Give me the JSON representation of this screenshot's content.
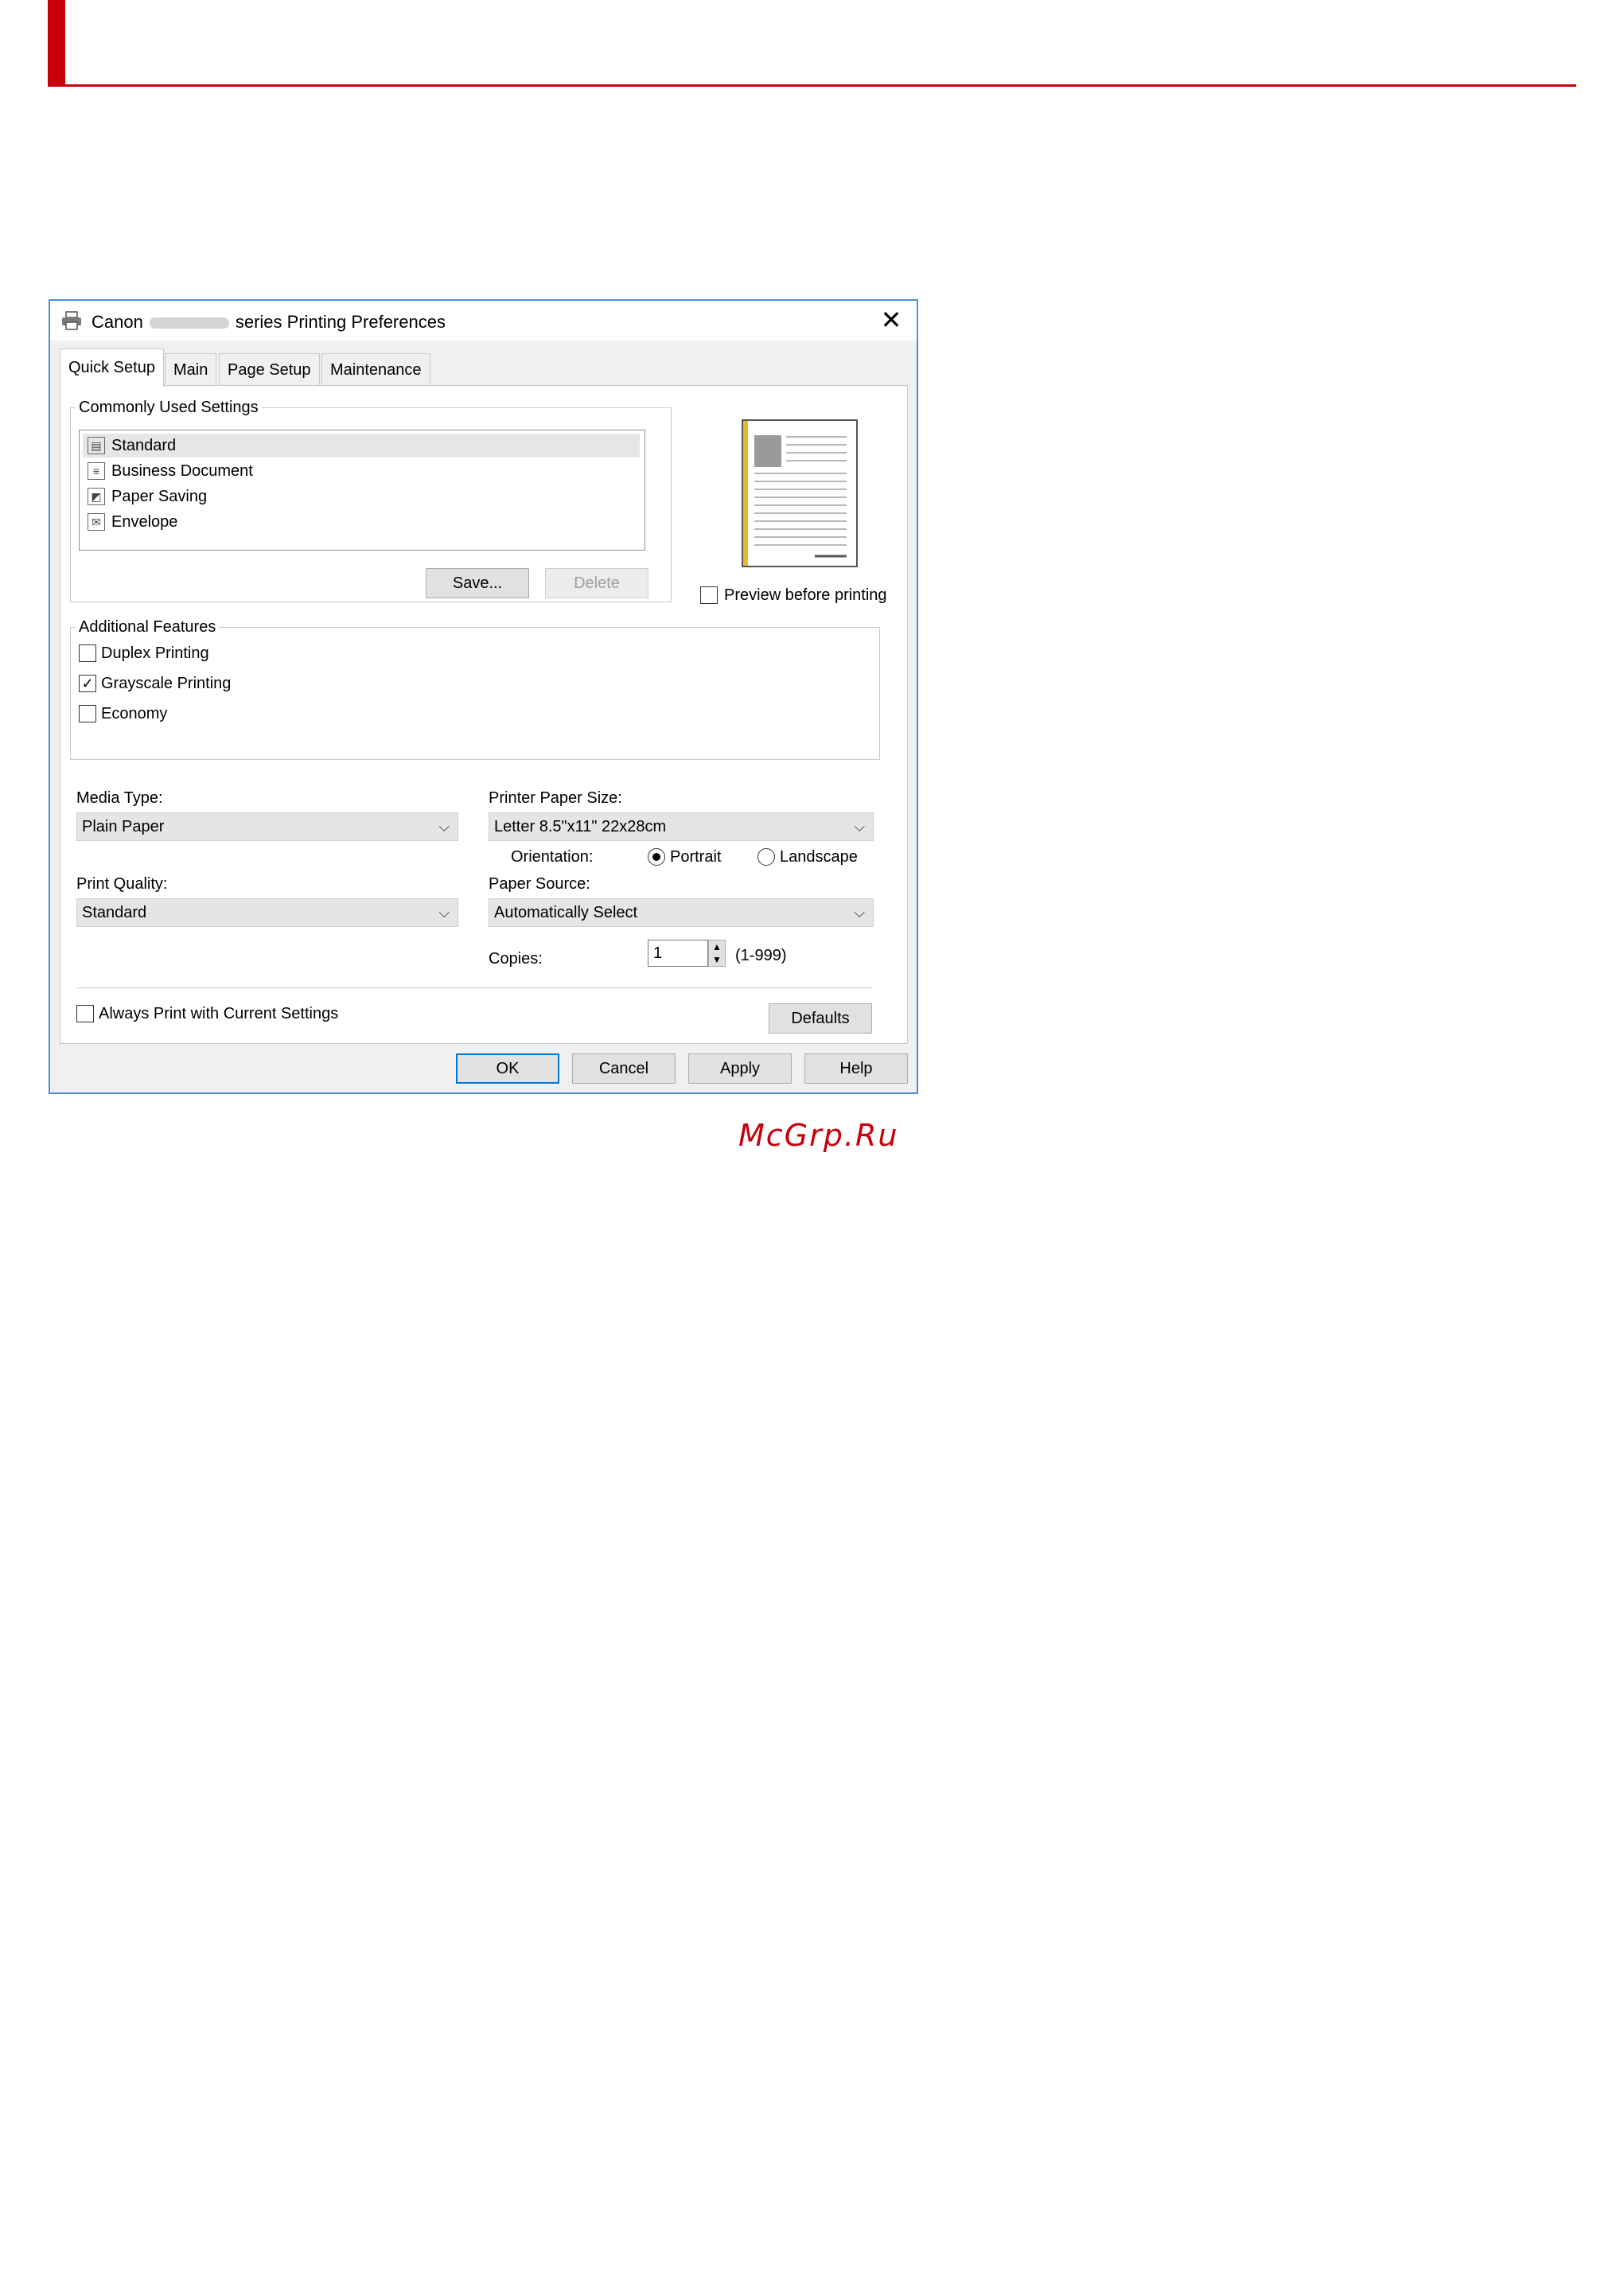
{
  "dialog": {
    "title_prefix": "Canon",
    "title_suffix": "series Printing Preferences",
    "close_glyph": "✕"
  },
  "tabs": [
    {
      "label": "Quick Setup",
      "active": true
    },
    {
      "label": "Main"
    },
    {
      "label": "Page Setup"
    },
    {
      "label": "Maintenance"
    }
  ],
  "commonly_used": {
    "legend": "Commonly Used Settings",
    "items": [
      {
        "label": "Standard",
        "icon": "standard-icon",
        "selected": true
      },
      {
        "label": "Business Document",
        "icon": "business-document-icon"
      },
      {
        "label": "Paper Saving",
        "icon": "paper-saving-icon"
      },
      {
        "label": "Envelope",
        "icon": "envelope-icon"
      }
    ],
    "save_label": "Save...",
    "delete_label": "Delete"
  },
  "preview_before_printing": {
    "label": "Preview before printing",
    "checked": false
  },
  "additional_features": {
    "legend": "Additional Features",
    "items": [
      {
        "label": "Duplex Printing",
        "checked": false
      },
      {
        "label": "Grayscale Printing",
        "checked": true
      },
      {
        "label": "Economy",
        "checked": false
      }
    ]
  },
  "media_type": {
    "label": "Media Type:",
    "value": "Plain Paper"
  },
  "printer_paper_size": {
    "label": "Printer Paper Size:",
    "value": "Letter 8.5\"x11\" 22x28cm"
  },
  "orientation": {
    "label": "Orientation:",
    "portrait": "Portrait",
    "landscape": "Landscape",
    "selected": "Portrait"
  },
  "print_quality": {
    "label": "Print Quality:",
    "value": "Standard"
  },
  "paper_source": {
    "label": "Paper Source:",
    "value": "Automatically Select"
  },
  "copies": {
    "label": "Copies:",
    "value": "1",
    "range": "(1-999)"
  },
  "always_print": {
    "label": "Always Print with Current Settings",
    "checked": false
  },
  "defaults_label": "Defaults",
  "footer_buttons": {
    "ok": "OK",
    "cancel": "Cancel",
    "apply": "Apply",
    "help": "Help"
  },
  "watermark": "McGrp.Ru",
  "colors": {
    "accent_red": "#c8000a",
    "dialog_border": "#4a90d9",
    "preview_yellow": "#e8b830"
  }
}
